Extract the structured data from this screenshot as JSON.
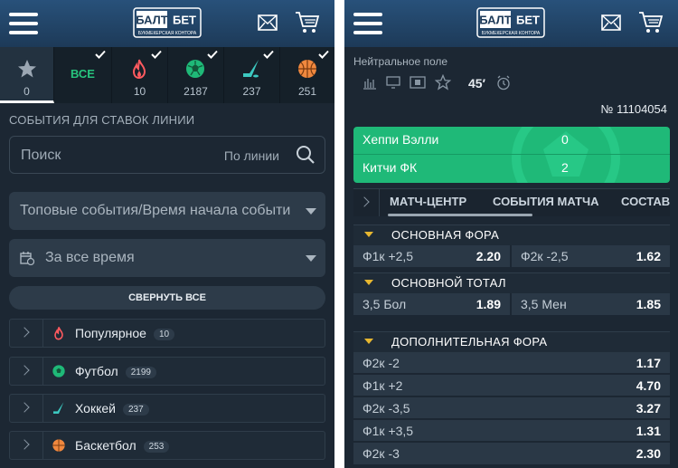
{
  "left": {
    "sports": [
      {
        "key": "favorites",
        "count": "0"
      },
      {
        "key": "all",
        "label": "ВСЕ",
        "count": ""
      },
      {
        "key": "popular",
        "count": "10"
      },
      {
        "key": "football",
        "count": "2187"
      },
      {
        "key": "hockey",
        "count": "237"
      },
      {
        "key": "basketball",
        "count": "251"
      }
    ],
    "section_title": "СОБЫТИЯ ДЛЯ СТАВОК ЛИНИИ",
    "search": {
      "placeholder": "Поиск",
      "mode": "По линии"
    },
    "sort_select": "Топовые события/Время начала событи",
    "period_select": "За все время",
    "collapse_label": "СВЕРНУТЬ ВСЕ",
    "categories": [
      {
        "label": "Популярное",
        "count": "10"
      },
      {
        "label": "Футбол",
        "count": "2199"
      },
      {
        "label": "Хоккей",
        "count": "237"
      },
      {
        "label": "Баскетбол",
        "count": "253"
      }
    ]
  },
  "right": {
    "venue": "Нейтральное поле",
    "minute": "45′",
    "event_number": "№ 11104054",
    "teams": [
      {
        "name": "Хеппи Вэлли",
        "score": "0"
      },
      {
        "name": "Китчи ФК",
        "score": "2"
      }
    ],
    "tabs": [
      "МАТЧ-ЦЕНТР",
      "СОБЫТИЯ МАТЧА",
      "СОСТАВ"
    ],
    "markets": [
      {
        "title": "ОСНОВНАЯ ФОРА",
        "rows": [
          [
            {
              "name": "Ф1к +2,5",
              "odd": "2.20"
            },
            {
              "name": "Ф2к -2,5",
              "odd": "1.62"
            }
          ]
        ]
      },
      {
        "title": "ОСНОВНОЙ ТОТАЛ",
        "rows": [
          [
            {
              "name": "3,5 Бол",
              "odd": "1.89"
            },
            {
              "name": "3,5 Мен",
              "odd": "1.85"
            }
          ]
        ]
      },
      {
        "title": "ДОПОЛНИТЕЛЬНАЯ ФОРА",
        "rows": [
          [
            {
              "name": "Ф2к -2",
              "odd": "1.17"
            }
          ],
          [
            {
              "name": "Ф1к +2",
              "odd": "4.70"
            }
          ],
          [
            {
              "name": "Ф2к -3,5",
              "odd": "3.27"
            }
          ],
          [
            {
              "name": "Ф1к +3,5",
              "odd": "1.31"
            }
          ],
          [
            {
              "name": "Ф2к -3",
              "odd": "2.30"
            }
          ]
        ]
      }
    ]
  },
  "brand": {
    "logo_left": "БАЛТ",
    "logo_right": "БЕТ",
    "tagline": "БУКМЕКЕРСКАЯ КОНТОРА",
    "accent": "#1fb978",
    "header": "#1d3a58",
    "bg": "#1c2733",
    "arrow": "#e7b730"
  }
}
